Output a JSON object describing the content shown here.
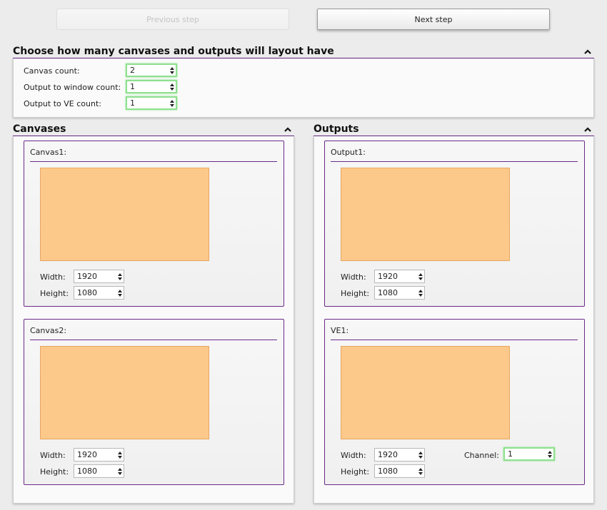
{
  "steps": {
    "previous_label": "Previous step",
    "next_label": "Next step"
  },
  "layout_section": {
    "title": "Choose how many canvases and outputs will layout have",
    "fields": [
      {
        "label": "Canvas count:",
        "value": "2"
      },
      {
        "label": "Output to window count:",
        "value": "1"
      },
      {
        "label": "Output to VE count:",
        "value": "1"
      }
    ]
  },
  "canvases": {
    "title": "Canvases",
    "items": [
      {
        "name": "Canvas1:",
        "width_label": "Width:",
        "width": "1920",
        "height_label": "Height:",
        "height": "1080"
      },
      {
        "name": "Canvas2:",
        "width_label": "Width:",
        "width": "1920",
        "height_label": "Height:",
        "height": "1080"
      }
    ]
  },
  "outputs": {
    "title": "Outputs",
    "items": [
      {
        "name": "Output1:",
        "width_label": "Width:",
        "width": "1920",
        "height_label": "Height:",
        "height": "1080"
      },
      {
        "name": "VE1:",
        "width_label": "Width:",
        "width": "1920",
        "height_label": "Height:",
        "height": "1080",
        "channel_label": "Channel:",
        "channel": "1"
      }
    ]
  },
  "colors": {
    "accent": "#6b2b8a",
    "preview_fill": "#fdc98a",
    "valid_border": "#8fe08f"
  },
  "icons": {
    "collapse": "chevron-up-icon",
    "spin_up": "spin-up-icon",
    "spin_down": "spin-down-icon"
  }
}
